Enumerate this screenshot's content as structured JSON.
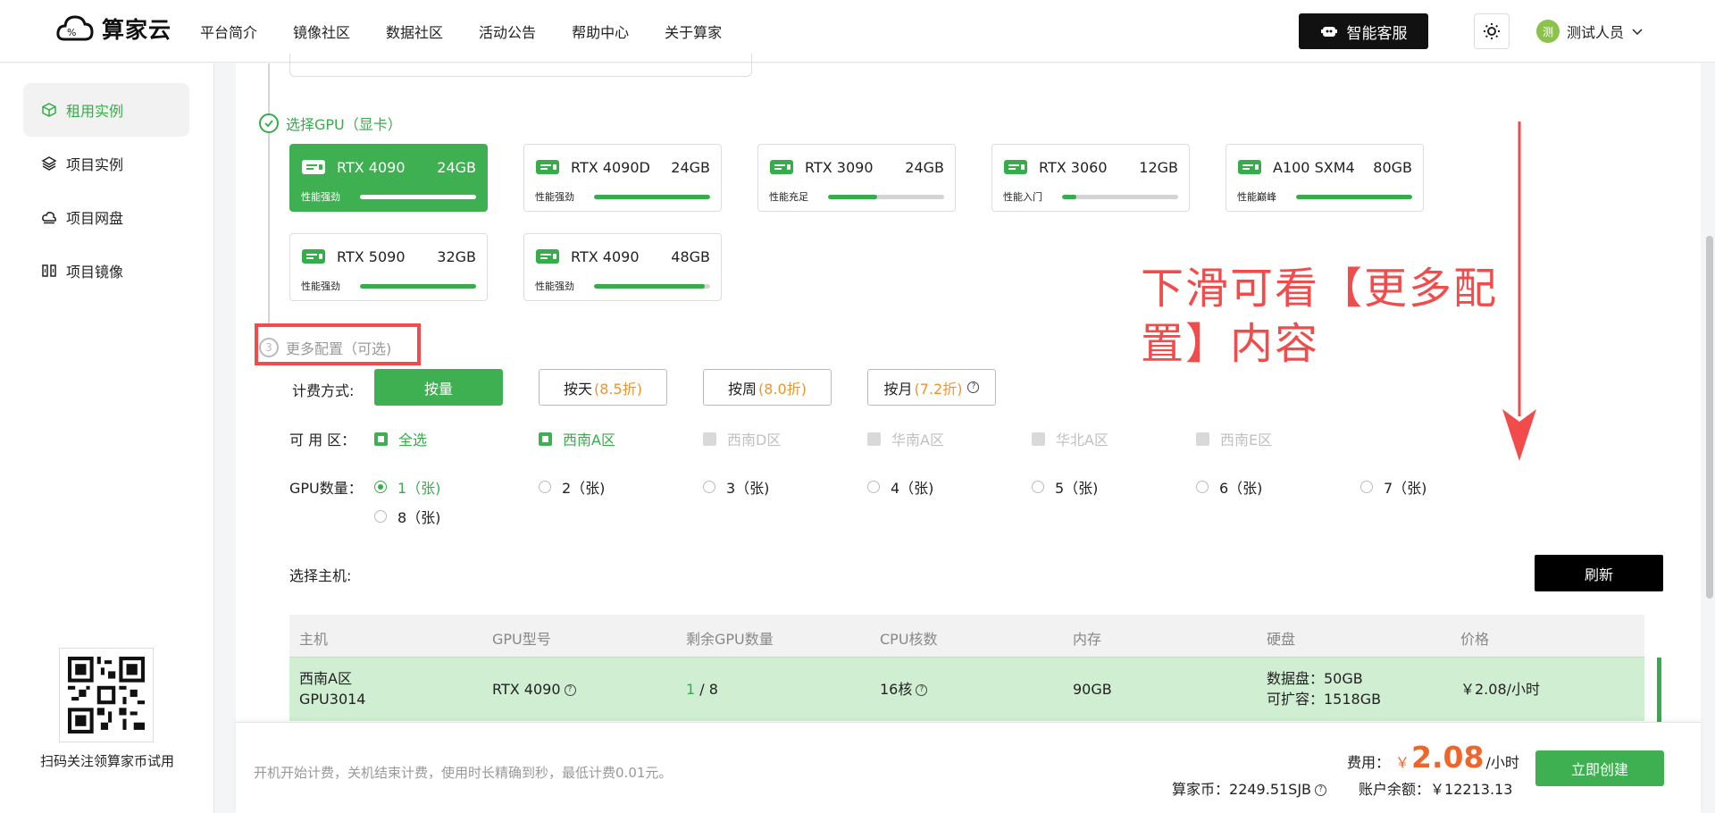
{
  "brand": {
    "name": "算家云"
  },
  "nav": [
    "平台简介",
    "镜像社区",
    "数据社区",
    "活动公告",
    "帮助中心",
    "关于算家"
  ],
  "header": {
    "service_label": "智能客服",
    "user_name": "测试人员",
    "avatar_char": "测"
  },
  "sidebar": {
    "items": [
      {
        "label": "租用实例",
        "icon": "cube-icon",
        "active": true
      },
      {
        "label": "项目实例",
        "icon": "layers-icon"
      },
      {
        "label": "项目网盘",
        "icon": "cloud-drive-icon"
      },
      {
        "label": "项目镜像",
        "icon": "image-icon"
      }
    ],
    "qr_caption": "扫码关注领算家币试用"
  },
  "steps": {
    "gpu_title": "选择GPU（显卡）",
    "more_title": "更多配置（可选)",
    "more_index": "3"
  },
  "gpu_cards": [
    {
      "name": "RTX 4090",
      "mem": "24GB",
      "level": "性能强劲",
      "perf": 1.0,
      "selected": true
    },
    {
      "name": "RTX 4090D",
      "mem": "24GB",
      "level": "性能强劲",
      "perf": 1.0
    },
    {
      "name": "RTX 3090",
      "mem": "24GB",
      "level": "性能充足",
      "perf": 0.42
    },
    {
      "name": "RTX 3060",
      "mem": "12GB",
      "level": "性能入门",
      "perf": 0.12
    },
    {
      "name": "A100 SXM4",
      "mem": "80GB",
      "level": "性能巅峰",
      "perf": 1.0
    },
    {
      "name": "RTX 5090",
      "mem": "32GB",
      "level": "性能强劲",
      "perf": 1.0
    },
    {
      "name": "RTX 4090",
      "mem": "48GB",
      "level": "性能强劲",
      "perf": 0.95
    }
  ],
  "annotation": {
    "line1": "下滑可看【更多配",
    "line2": "置】内容"
  },
  "billing": {
    "label": "计费方式:",
    "options": [
      {
        "label": "按量",
        "discount": "",
        "active": true
      },
      {
        "label": "按天",
        "discount": "(8.5折)"
      },
      {
        "label": "按周",
        "discount": "(8.0折)"
      },
      {
        "label": "按月",
        "discount": "(7.2折)"
      }
    ]
  },
  "zones": {
    "label": "可 用 区：",
    "options": [
      {
        "label": "全选",
        "checked": true
      },
      {
        "label": "西南A区",
        "checked": true
      },
      {
        "label": "西南D区",
        "disabled": true
      },
      {
        "label": "华南A区",
        "disabled": true
      },
      {
        "label": "华北A区",
        "disabled": true
      },
      {
        "label": "西南E区",
        "disabled": true
      }
    ]
  },
  "gpu_count": {
    "label": "GPU数量：",
    "options": [
      "1（张)",
      "2（张)",
      "3（张)",
      "4（张)",
      "5（张)",
      "6（张)",
      "7（张)",
      "8（张)"
    ],
    "selected_index": 0
  },
  "host": {
    "label": "选择主机:",
    "refresh_label": "刷新"
  },
  "table": {
    "headers": [
      "主机",
      "GPU型号",
      "剩余GPU数量",
      "CPU核数",
      "内存",
      "硬盘",
      "价格"
    ],
    "row": {
      "zone": "西南A区",
      "host": "GPU3014",
      "gpu": "RTX 4090",
      "remain": "1",
      "total": "/ 8",
      "cpu": "16核",
      "mem": "90GB",
      "disk1": "数据盘：50GB",
      "disk2": "可扩容：1518GB",
      "price": "￥2.08/小时"
    }
  },
  "footer": {
    "note": "开机开始计费，关机结束计费，使用时长精确到秒，最低计费0.01元。",
    "fee_label": "费用：",
    "currency": "￥",
    "fee": "2.08",
    "fee_unit": "/小时",
    "coin_label": "算家币：",
    "coin": "2249.51SJB",
    "balance_label": "账户余额：",
    "balance": "￥12213.13",
    "create_label": "立即创建"
  },
  "colors": {
    "accent": "#3fb051",
    "annotation": "#f24b4b",
    "price": "#f0652b",
    "discount": "#f0932b"
  }
}
